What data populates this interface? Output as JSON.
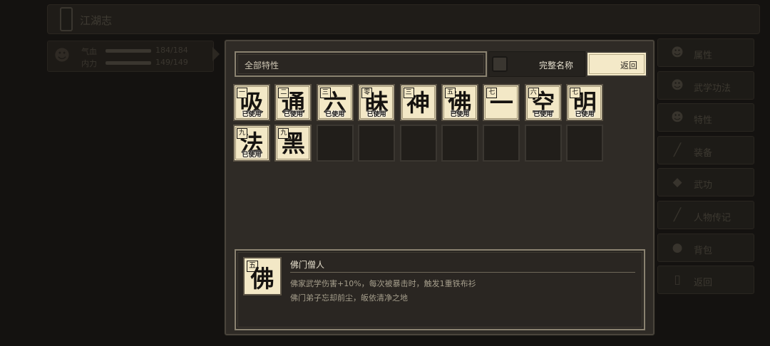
{
  "background": {
    "title": "江湖志",
    "character": {
      "stats": [
        {
          "label": "气血",
          "value": "184/184",
          "fill": 1.0
        },
        {
          "label": "内力",
          "value": "149/149",
          "fill": 1.0
        }
      ]
    },
    "side_menu": [
      {
        "label": "属性",
        "icon": "person-icon"
      },
      {
        "label": "武学功法",
        "icon": "scroll-icon"
      },
      {
        "label": "特性",
        "icon": "trait-icon"
      },
      {
        "label": "装备",
        "icon": "sword-icon"
      },
      {
        "label": "武功",
        "icon": "book-icon"
      },
      {
        "label": "人物传记",
        "icon": "sword-icon"
      },
      {
        "label": "背包",
        "icon": "bag-icon"
      },
      {
        "label": "返回",
        "icon": "door-icon"
      }
    ]
  },
  "panel": {
    "filter_label": "全部特性",
    "fullname_label": "完整名称",
    "fullname_checked": false,
    "back_label": "返回",
    "traits": [
      {
        "char": "吸",
        "grade": "一",
        "used": "已使用"
      },
      {
        "char": "通",
        "grade": "二",
        "used": "已使用"
      },
      {
        "char": "六",
        "grade": "三",
        "used": "已使用"
      },
      {
        "char": "眛",
        "grade": "零",
        "used": "已使用"
      },
      {
        "char": "神",
        "grade": "三",
        "used": ""
      },
      {
        "char": "佛",
        "grade": "五",
        "used": "已使用"
      },
      {
        "char": "一",
        "grade": "七",
        "used": ""
      },
      {
        "char": "空",
        "grade": "六",
        "used": "已使用"
      },
      {
        "char": "明",
        "grade": "七",
        "used": "已使用"
      },
      {
        "char": "法",
        "grade": "九",
        "used": "已使用"
      },
      {
        "char": "黑",
        "grade": "九",
        "used": ""
      }
    ],
    "empty_slots": 7,
    "detail": {
      "char": "佛",
      "grade": "五",
      "name": "佛门僧人",
      "line1": "佛家武学伤害+10%，每次被暴击时，触发1重铁布衫",
      "line2": "佛门弟子忘却前尘，皈依清净之地"
    }
  }
}
